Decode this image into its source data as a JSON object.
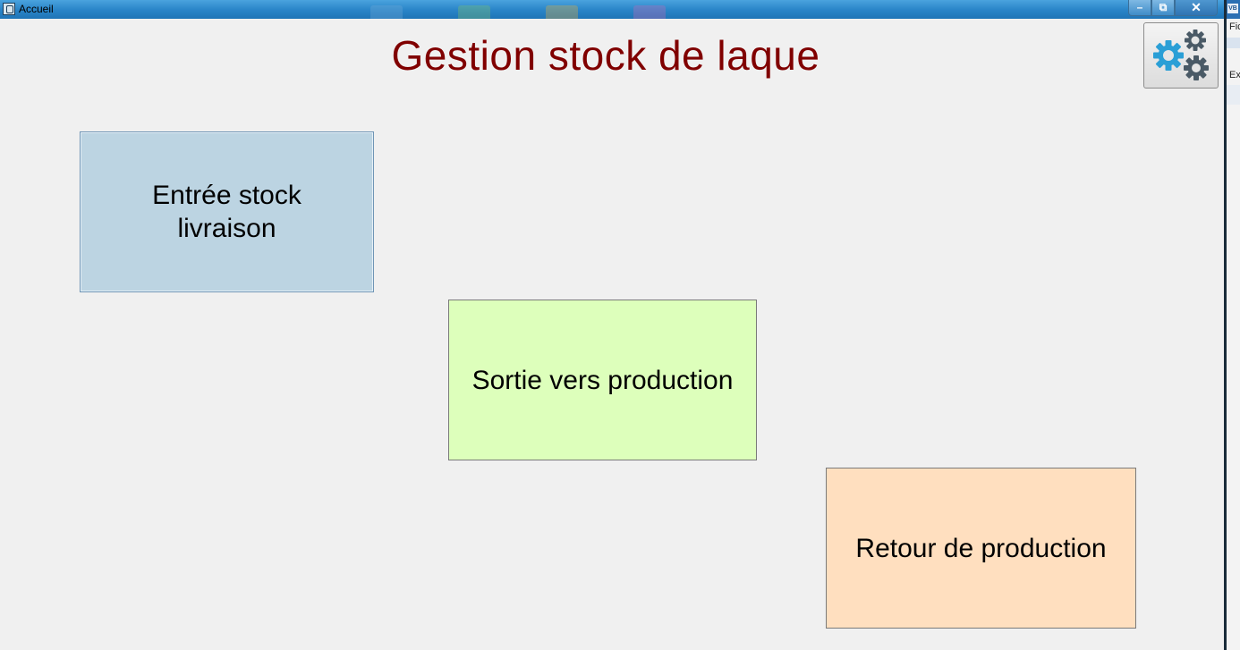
{
  "window": {
    "title": "Accueil",
    "minimize_glyph": "–",
    "maximize_glyph": "⧉",
    "close_glyph": "✕",
    "title_color": "#2b86c9"
  },
  "page": {
    "title": "Gestion stock de laque",
    "title_color": "#800000",
    "background": "#f0f0f0"
  },
  "settings": {
    "icon": "gears-icon"
  },
  "buttons": {
    "entree": {
      "label": "Entrée stock livraison",
      "color": "#bcd4e2"
    },
    "sortie": {
      "label": "Sortie vers production",
      "color": "#ddffbb"
    },
    "retour": {
      "label": "Retour de production",
      "color": "#ffdfbf"
    }
  },
  "side_window": {
    "badge": "VB",
    "fragment_1": "Fic",
    "fragment_2": "Ex"
  }
}
